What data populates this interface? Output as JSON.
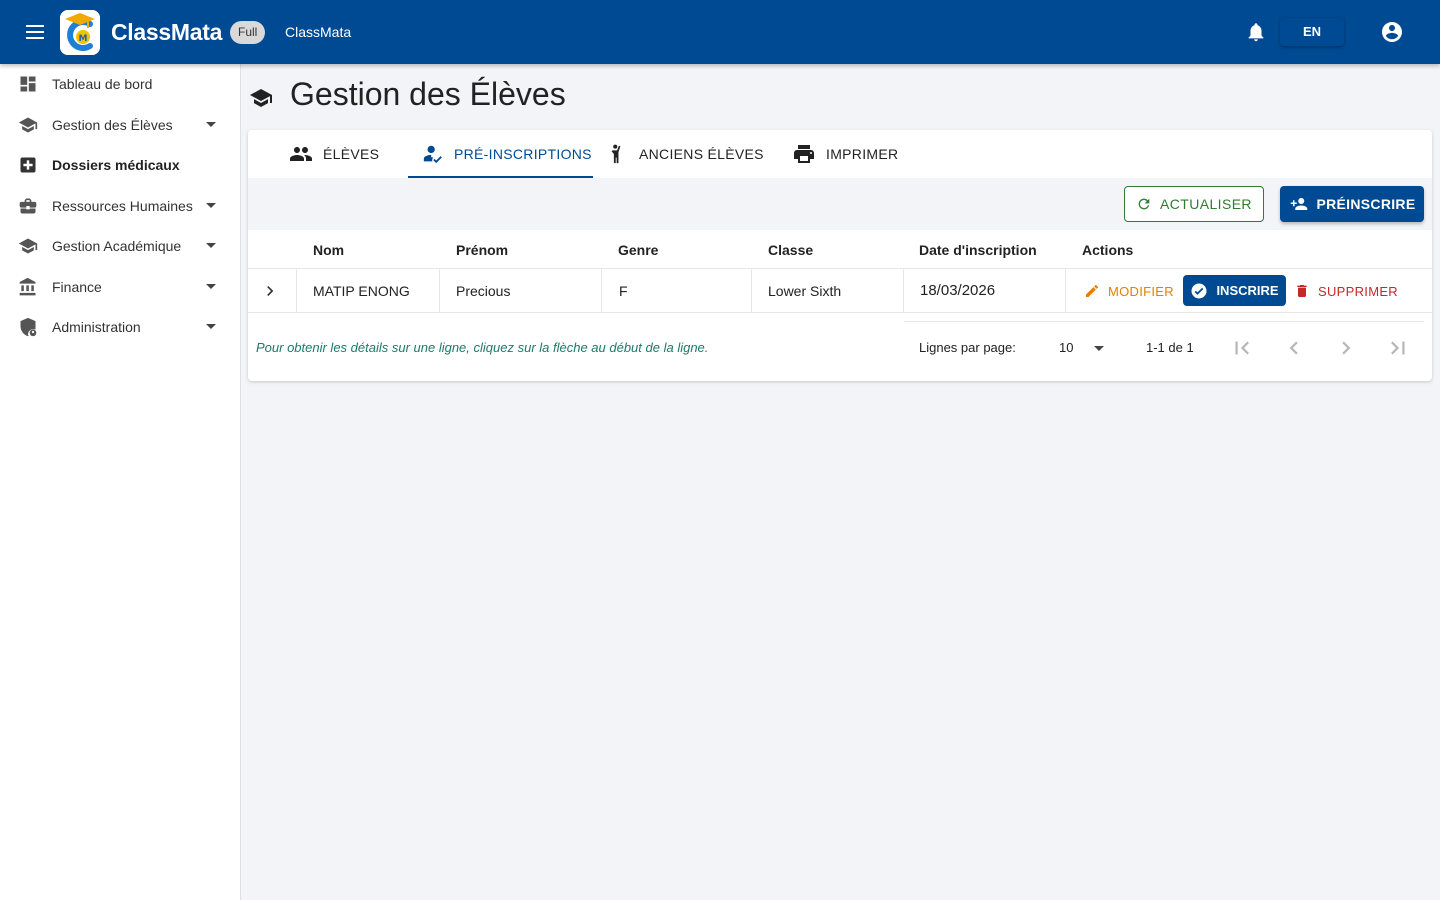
{
  "header": {
    "brand": "ClassMata",
    "plan_badge": "Full",
    "organization": "ClassMata",
    "language": "EN",
    "brand_color": "#004a93"
  },
  "sidebar": {
    "items": [
      {
        "label": "Tableau de bord",
        "icon": "dashboard-icon",
        "expandable": false,
        "bold": false
      },
      {
        "label": "Gestion des Élèves",
        "icon": "school-icon",
        "expandable": true,
        "bold": false
      },
      {
        "label": "Dossiers médicaux",
        "icon": "medical-icon",
        "expandable": false,
        "bold": true
      },
      {
        "label": "Ressources Humaines",
        "icon": "briefcase-icon",
        "expandable": true,
        "bold": false
      },
      {
        "label": "Gestion Académique",
        "icon": "school-icon",
        "expandable": true,
        "bold": false
      },
      {
        "label": "Finance",
        "icon": "bank-icon",
        "expandable": true,
        "bold": false
      },
      {
        "label": "Administration",
        "icon": "admin-shield-icon",
        "expandable": true,
        "bold": false
      }
    ]
  },
  "page": {
    "title": "Gestion des Élèves"
  },
  "tabs": [
    {
      "label": "ÉLÈVES",
      "icon": "people-icon",
      "active": false
    },
    {
      "label": "PRÉ-INSCRIPTIONS",
      "icon": "person-check-icon",
      "active": true
    },
    {
      "label": "ANCIENS ÉLÈVES",
      "icon": "alumni-icon",
      "active": false
    },
    {
      "label": "IMPRIMER",
      "icon": "printer-icon",
      "active": false
    }
  ],
  "toolbar": {
    "refresh_label": "ACTUALISER",
    "preregister_label": "PRÉINSCRIRE"
  },
  "table": {
    "columns": [
      "Nom",
      "Prénom",
      "Genre",
      "Classe",
      "Date d'inscription",
      "Actions"
    ],
    "rows": [
      {
        "nom": "MATIP ENONG",
        "prenom": "Precious",
        "genre": "F",
        "classe": "Lower Sixth",
        "date": "18/03/2026"
      }
    ],
    "actions": {
      "edit": "MODIFIER",
      "enroll": "INSCRIRE",
      "delete": "SUPPRIMER"
    }
  },
  "footer": {
    "hint": "Pour obtenir les détails sur une ligne, cliquez sur la flèche au début de la ligne.",
    "rows_per_page_label": "Lignes par page:",
    "rows_per_page": "10",
    "range": "1-1 de 1"
  }
}
